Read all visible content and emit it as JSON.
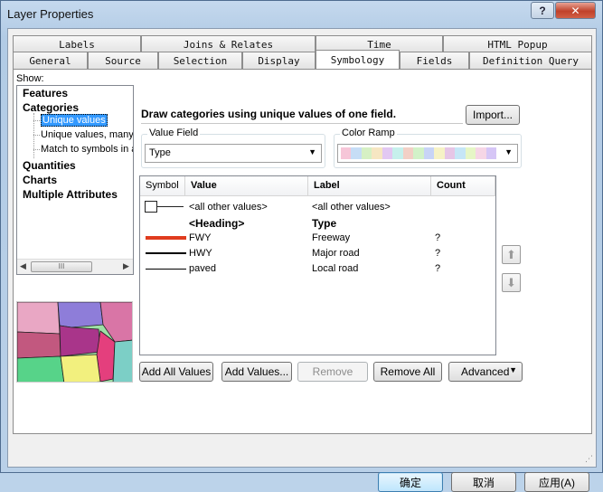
{
  "window": {
    "title": "Layer Properties",
    "help_label": "?",
    "close_label": "✕"
  },
  "tabs_row1": [
    {
      "label": "Labels"
    },
    {
      "label": "Joins & Relates"
    },
    {
      "label": "Time"
    },
    {
      "label": "HTML Popup"
    }
  ],
  "tabs_row2": [
    {
      "label": "General"
    },
    {
      "label": "Source"
    },
    {
      "label": "Selection"
    },
    {
      "label": "Display"
    },
    {
      "label": "Symbology",
      "active": true
    },
    {
      "label": "Fields"
    },
    {
      "label": "Definition Query"
    }
  ],
  "show": {
    "label": "Show:",
    "tree": {
      "features": "Features",
      "categories": "Categories",
      "unique_values": "Unique values",
      "unique_values_many": "Unique values, many",
      "match_symbols": "Match to symbols in a",
      "quantities": "Quantities",
      "charts": "Charts",
      "multiple_attributes": "Multiple Attributes"
    },
    "scroll_thumb": "III"
  },
  "symbology": {
    "description": "Draw categories using unique values of one field.",
    "import_label": "Import...",
    "value_field": {
      "legend": "Value Field",
      "value": "Type"
    },
    "color_ramp": {
      "legend": "Color Ramp",
      "colors": [
        "#f6c6d8",
        "#c6ddf6",
        "#d6f0c4",
        "#f6e6c2",
        "#e2c8f2",
        "#c6f0ec",
        "#f2d0c6",
        "#d2f2c8",
        "#c8d4f6",
        "#f6f2c6",
        "#e6c6e6",
        "#c6e6f6",
        "#e6f6c6",
        "#f6d6e6",
        "#d6c6f6"
      ]
    },
    "grid": {
      "headers": {
        "symbol": "Symbol",
        "value": "Value",
        "label": "Label",
        "count": "Count"
      },
      "rows": [
        {
          "value": "<all other values>",
          "label": "<all other values>",
          "count": "",
          "symbol": "box"
        },
        {
          "value": "<Heading>",
          "label": "Type",
          "count": "",
          "symbol": "none",
          "bold": true
        },
        {
          "value": "FWY",
          "label": "Freeway",
          "count": "?",
          "symbol": "line-red"
        },
        {
          "value": "HWY",
          "label": "Major road",
          "count": "?",
          "symbol": "line-black-thick"
        },
        {
          "value": "paved",
          "label": "Local road",
          "count": "?",
          "symbol": "line-black"
        }
      ],
      "symbol_colors": {
        "fwy": "#e03c1e",
        "hwy": "#000000",
        "paved": "#000000"
      }
    },
    "buttons": {
      "add_all": "Add All Values",
      "add_values": "Add Values...",
      "remove": "Remove",
      "remove_all": "Remove All",
      "advanced": "Advanced"
    },
    "move_up_icon": "up-arrow-icon",
    "move_down_icon": "down-arrow-icon"
  },
  "footer": {
    "ok": "确定",
    "cancel": "取消",
    "apply": "应用(A)"
  }
}
